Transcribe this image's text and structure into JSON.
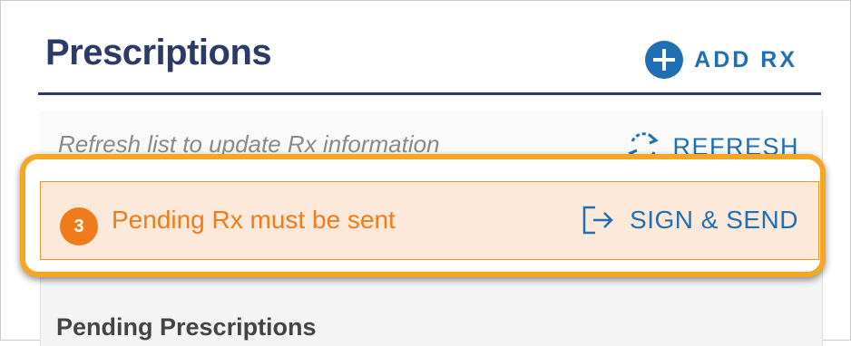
{
  "header": {
    "title": "Prescriptions",
    "add_label": "ADD RX"
  },
  "refresh": {
    "message": "Refresh list to update Rx information",
    "button_label": "REFRESH"
  },
  "alert": {
    "count": "3",
    "message": "Pending Rx must be sent",
    "button_label": "SIGN & SEND"
  },
  "section": {
    "title": "Pending Prescriptions"
  },
  "colors": {
    "title_navy": "#2b3a67",
    "link_blue": "#1f6fb2",
    "alert_orange": "#ef7b1a",
    "alert_bg": "#fde9d9",
    "highlight": "#f5a623"
  },
  "icons": {
    "add": "plus-circle-icon",
    "refresh": "refresh-icon",
    "sign": "sign-send-icon"
  }
}
